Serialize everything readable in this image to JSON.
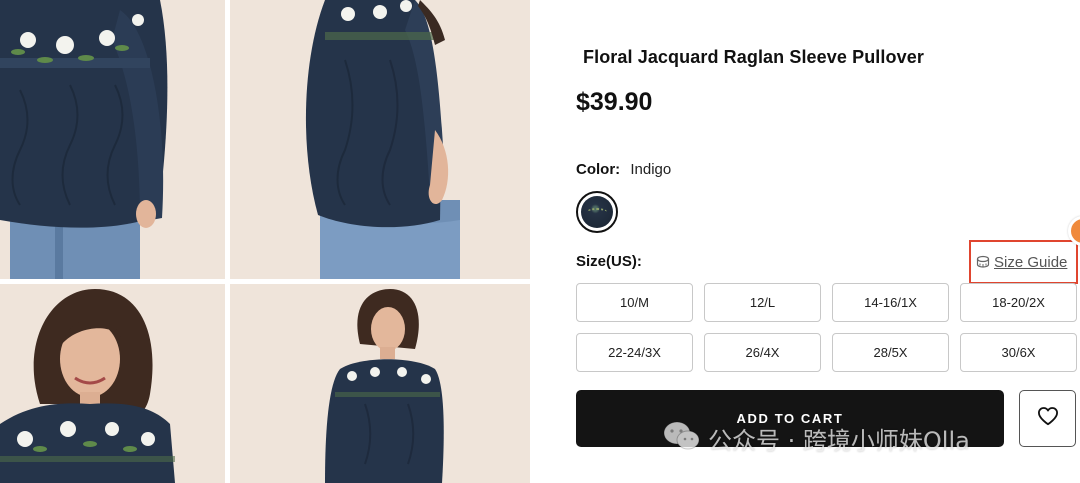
{
  "product": {
    "title": "Floral Jacquard Raglan Sleeve Pullover",
    "price": "$39.90"
  },
  "color": {
    "label": "Color:",
    "value": "Indigo"
  },
  "size": {
    "label": "Size(US):",
    "guide_label": "Size Guide",
    "options": [
      "10/M",
      "12/L",
      "14-16/1X",
      "18-20/2X",
      "22-24/3X",
      "26/4X",
      "28/5X",
      "30/6X"
    ]
  },
  "actions": {
    "add_to_cart": "ADD TO CART"
  },
  "icons": {
    "wishlist": "heart-icon",
    "size_guide": "ruler-icon"
  },
  "watermark": {
    "text": "公众号 · 跨境小师妹Olla"
  },
  "colors": {
    "accent_red": "#e0452f",
    "button_dark": "#141414",
    "photo_bg": "#efe4da",
    "sweater": "#25344a",
    "jeans": "#6f8fb5"
  }
}
